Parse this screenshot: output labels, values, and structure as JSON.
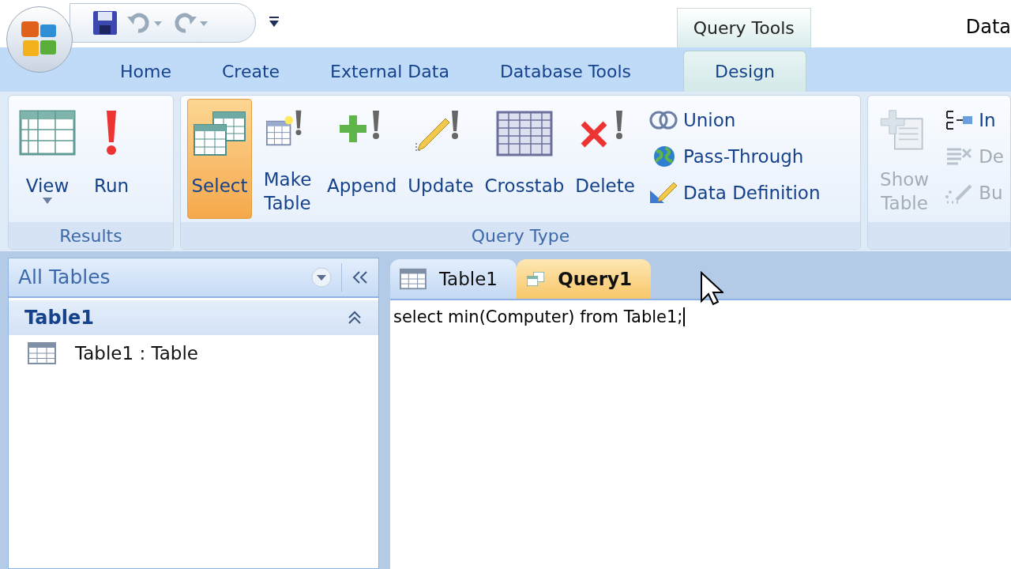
{
  "contextual_tab": {
    "title": "Query Tools"
  },
  "window": {
    "title": "Data"
  },
  "ribbon_tabs": [
    {
      "label": "Home",
      "selected": false
    },
    {
      "label": "Create",
      "selected": false
    },
    {
      "label": "External Data",
      "selected": false
    },
    {
      "label": "Database Tools",
      "selected": false
    },
    {
      "label": "Design",
      "selected": true
    }
  ],
  "groups": [
    {
      "label": "Results",
      "buttons": [
        {
          "kind": "large",
          "label": "View",
          "dropdown": true,
          "selected": false,
          "disabled": false
        },
        {
          "kind": "large",
          "label": "Run",
          "selected": false,
          "disabled": false
        }
      ]
    },
    {
      "label": "Query Type",
      "buttons": [
        {
          "kind": "large",
          "label": "Select",
          "selected": true,
          "disabled": false
        },
        {
          "kind": "large",
          "label": "Make Table",
          "selected": false,
          "disabled": false
        },
        {
          "kind": "large",
          "label": "Append",
          "selected": false,
          "disabled": false
        },
        {
          "kind": "large",
          "label": "Update",
          "selected": false,
          "disabled": false
        },
        {
          "kind": "large",
          "label": "Crosstab",
          "selected": false,
          "disabled": false
        },
        {
          "kind": "large",
          "label": "Delete",
          "selected": false,
          "disabled": false
        },
        {
          "kind": "small",
          "label": "Union",
          "selected": false,
          "disabled": false
        },
        {
          "kind": "small",
          "label": "Pass-Through",
          "selected": false,
          "disabled": false
        },
        {
          "kind": "small",
          "label": "Data Definition",
          "selected": false,
          "disabled": false
        }
      ]
    },
    {
      "buttons": [
        {
          "kind": "large",
          "label": "Show Table",
          "selected": false,
          "disabled": true
        },
        {
          "kind": "small",
          "label": "In",
          "selected": false,
          "disabled": false
        },
        {
          "kind": "small",
          "label": "De",
          "selected": false,
          "disabled": true
        },
        {
          "kind": "small",
          "label": "Bu",
          "selected": false,
          "disabled": true
        }
      ]
    }
  ],
  "nav_pane": {
    "title": "All Tables",
    "group": {
      "title": "Table1",
      "expanded": true,
      "items": [
        {
          "label": "Table1 : Table"
        }
      ]
    }
  },
  "doc_tabs": [
    {
      "label": "Table1",
      "selected": false
    },
    {
      "label": "Query1",
      "selected": true
    }
  ],
  "editor": {
    "value": "select min(Computer) from Table1;"
  }
}
